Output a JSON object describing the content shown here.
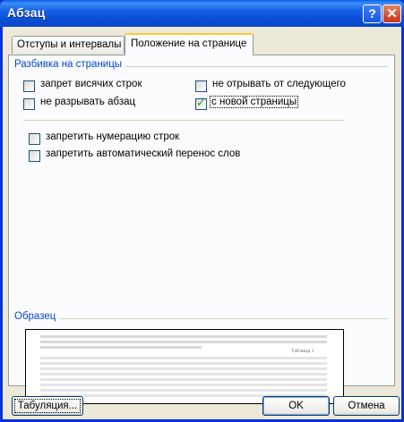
{
  "window": {
    "title": "Абзац",
    "help_glyph": "?",
    "close_glyph": "✕"
  },
  "tabs": [
    {
      "label": "Отступы и интервалы",
      "active": false
    },
    {
      "label": "Положение на странице",
      "active": true
    }
  ],
  "pagination": {
    "group_label": "Разбивка на страницы",
    "widow_control": {
      "label": "запрет висячих строк",
      "checked": false
    },
    "keep_with_next": {
      "label": "не отрывать от следующего",
      "checked": false
    },
    "keep_lines_together": {
      "label": "не разрывать абзац",
      "checked": false
    },
    "page_break_before": {
      "label": "с новой страницы",
      "checked": true
    }
  },
  "options": {
    "suppress_line_numbers": {
      "label": "запретить нумерацию строк",
      "checked": false
    },
    "dont_hyphenate": {
      "label": "запретить автоматический перенос слов",
      "checked": false
    }
  },
  "preview": {
    "group_label": "Образец",
    "caption": "Таблица 1"
  },
  "buttons": {
    "tabs": "Табуляция...",
    "ok": "OK",
    "cancel": "Отмена"
  },
  "colors": {
    "title_bar": "#0a4fd6",
    "group_label": "#0046d5",
    "dialog_face": "#ece9d8",
    "check_mark": "#21a121"
  }
}
